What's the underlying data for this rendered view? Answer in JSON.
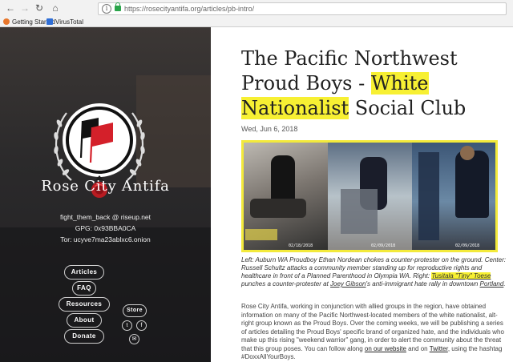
{
  "browser": {
    "url": "https://rosecityantifa.org/articles/pb-intro/",
    "bookmarks": [
      "Getting Started",
      "VirusTotal"
    ]
  },
  "sidebar": {
    "brand": "Rose City Antifa",
    "contact": [
      "fight_them_back @ riseup.net",
      "GPG: 0x93BBA0CA",
      "Tor: ucyve7ma23ablxc6.onion"
    ],
    "nav": [
      "Articles",
      "FAQ",
      "Resources",
      "About",
      "Donate"
    ],
    "store_label": "Store",
    "social_icons": [
      "twitter-icon",
      "facebook-icon",
      "email-icon"
    ]
  },
  "article": {
    "title_parts": [
      "The Pacific Northwest Proud Boys - ",
      "White Nationalist",
      " Social Club"
    ],
    "date": "Wed, Jun 6, 2018",
    "image_timestamps": [
      "02/18/2018",
      "02/09/2018",
      "02/09/2018"
    ],
    "caption_parts": [
      "Left: Auburn WA Proudboy Ethan Nordean chokes a counter-protester on the ground. Center: Russell Schultz attacks a community member standing up for reproductive rights and healthcare in front of a Planned Parenthood in Olympia WA. Right: ",
      "Tusitala \"Tiny\" Toese",
      " punches a counter-protester at ",
      "Joey Gibson",
      "'s anti-immigrant hate rally in downtown ",
      "Portland",
      "."
    ],
    "body_parts": [
      "Rose City Antifa, working in conjunction with allied groups in the region, have obtained information on many of the Pacific Northwest-located members of the white nationalist, alt-right group known as the Proud Boys. Over the coming weeks, we will be publishing a series of articles detailing the Proud Boys' specific brand of organized hate, and the individuals who make up this rising \"weekend warrior\" gang, in order to alert the community about the threat that this group poses. You can follow along ",
      "on our website",
      " and on ",
      "Twitter",
      ", using the hashtag #DoxxAllYourBoys."
    ]
  },
  "colors": {
    "highlight": "#f7f033",
    "sidebar_bg": "#2a2828",
    "logo_red": "#d4202a"
  }
}
